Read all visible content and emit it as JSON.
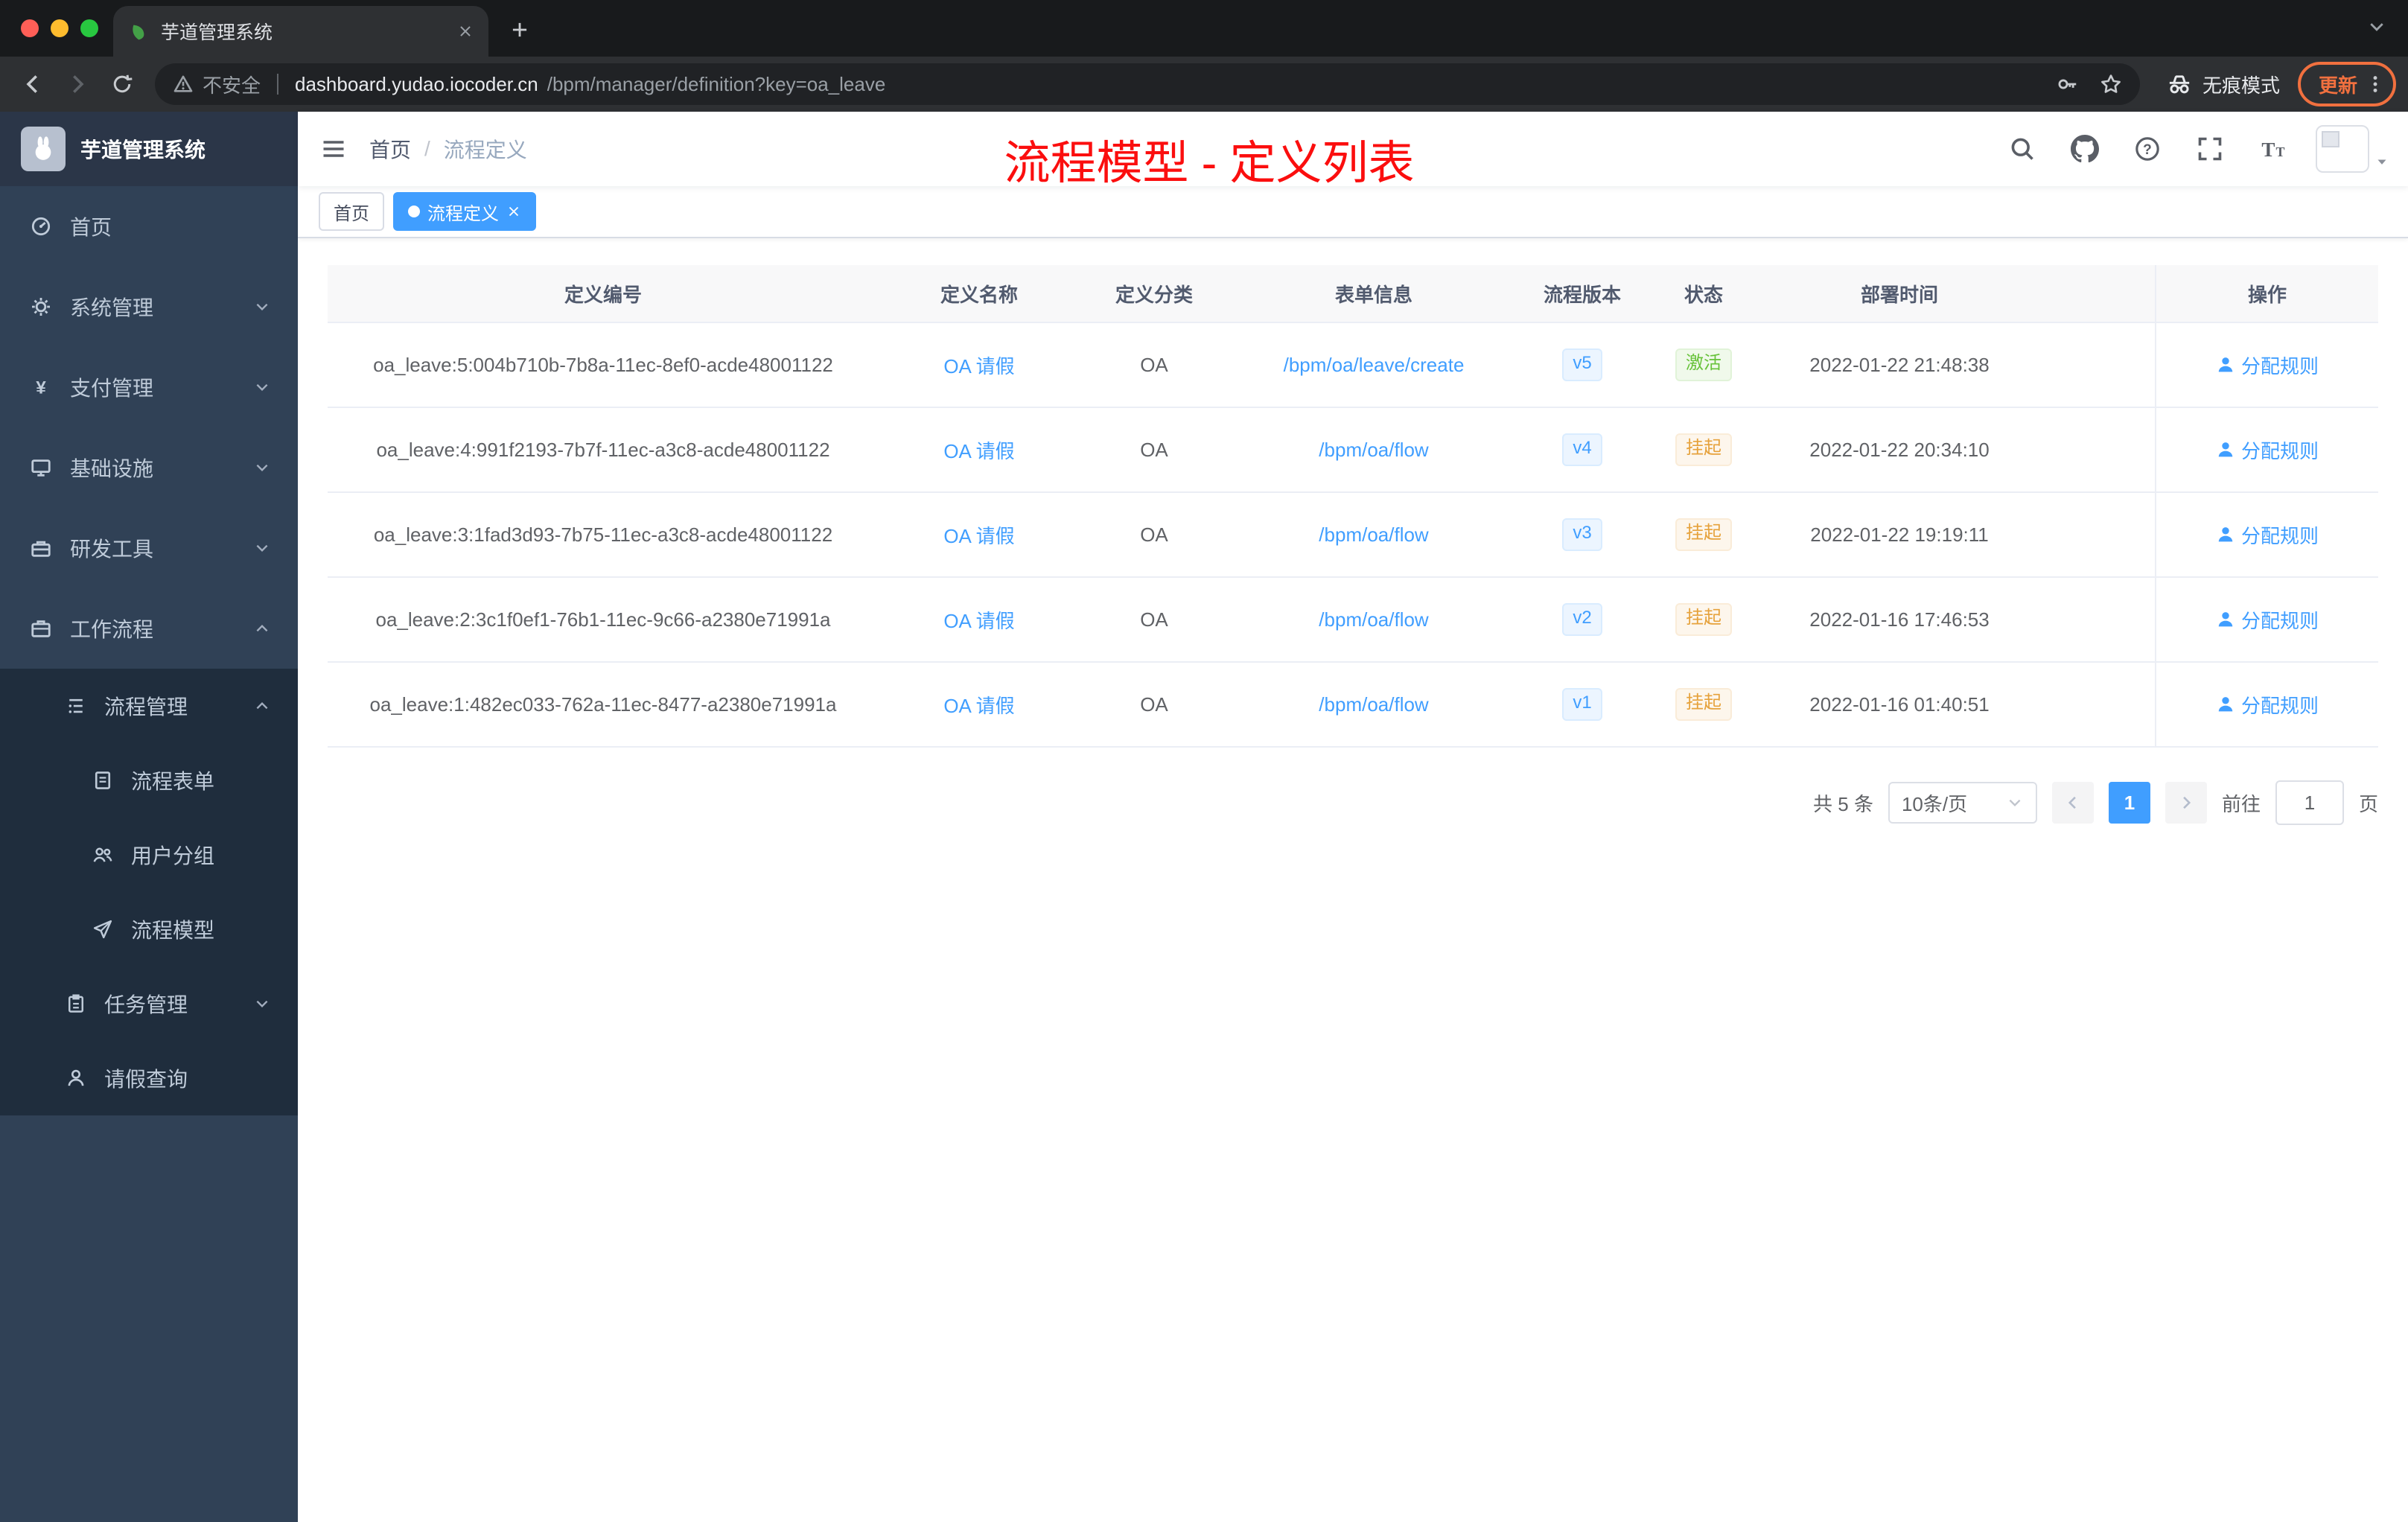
{
  "browser": {
    "tab_title": "芋道管理系统",
    "not_secure": "不安全",
    "url_host": "dashboard.yudao.iocoder.cn",
    "url_path": "/bpm/manager/definition?key=oa_leave",
    "incognito_label": "无痕模式",
    "update_label": "更新"
  },
  "sidebar": {
    "logo_title": "芋道管理系统",
    "items": [
      {
        "label": "首页"
      },
      {
        "label": "系统管理"
      },
      {
        "label": "支付管理"
      },
      {
        "label": "基础设施"
      },
      {
        "label": "研发工具"
      },
      {
        "label": "工作流程"
      },
      {
        "label": "流程管理"
      },
      {
        "label": "流程表单"
      },
      {
        "label": "用户分组"
      },
      {
        "label": "流程模型"
      },
      {
        "label": "任务管理"
      },
      {
        "label": "请假查询"
      }
    ]
  },
  "navbar": {
    "breadcrumb": [
      "首页",
      "流程定义"
    ],
    "breadcrumb_sep": "/"
  },
  "annotation": "流程模型 - 定义列表",
  "tags": [
    {
      "label": "首页"
    },
    {
      "label": "流程定义"
    }
  ],
  "table": {
    "columns": [
      "定义编号",
      "定义名称",
      "定义分类",
      "表单信息",
      "流程版本",
      "状态",
      "部署时间",
      "操作"
    ],
    "rows": [
      {
        "id": "oa_leave:5:004b710b-7b8a-11ec-8ef0-acde48001122",
        "name": "OA 请假",
        "category": "OA",
        "form": "/bpm/oa/leave/create",
        "version": "v5",
        "status": "激活",
        "time": "2022-01-22 21:48:38",
        "action": "分配规则"
      },
      {
        "id": "oa_leave:4:991f2193-7b7f-11ec-a3c8-acde48001122",
        "name": "OA 请假",
        "category": "OA",
        "form": "/bpm/oa/flow",
        "version": "v4",
        "status": "挂起",
        "time": "2022-01-22 20:34:10",
        "action": "分配规则"
      },
      {
        "id": "oa_leave:3:1fad3d93-7b75-11ec-a3c8-acde48001122",
        "name": "OA 请假",
        "category": "OA",
        "form": "/bpm/oa/flow",
        "version": "v3",
        "status": "挂起",
        "time": "2022-01-22 19:19:11",
        "action": "分配规则"
      },
      {
        "id": "oa_leave:2:3c1f0ef1-76b1-11ec-9c66-a2380e71991a",
        "name": "OA 请假",
        "category": "OA",
        "form": "/bpm/oa/flow",
        "version": "v2",
        "status": "挂起",
        "time": "2022-01-16 17:46:53",
        "action": "分配规则"
      },
      {
        "id": "oa_leave:1:482ec033-762a-11ec-8477-a2380e71991a",
        "name": "OA 请假",
        "category": "OA",
        "form": "/bpm/oa/flow",
        "version": "v1",
        "status": "挂起",
        "time": "2022-01-16 01:40:51",
        "action": "分配规则"
      }
    ]
  },
  "pagination": {
    "total": "共 5 条",
    "page_size": "10条/页",
    "current_page": "1",
    "goto_label": "前往",
    "goto_value": "1",
    "goto_unit": "页"
  },
  "colors": {
    "accent": "#409eff",
    "success": "#67c23a",
    "warning": "#e6a23c",
    "annotation_red": "#fb0e0e",
    "update_orange": "#f1703f",
    "sidebar_bg": "#304156",
    "submenu_bg": "#1f2d3d"
  },
  "icons": [
    "leaf-favicon",
    "back-icon",
    "forward-icon",
    "reload-icon",
    "warning-icon",
    "key-icon",
    "star-icon",
    "incognito-icon",
    "kebab-icon",
    "hamburger-icon",
    "search-icon",
    "github-icon",
    "help-icon",
    "fullscreen-icon",
    "font-size-icon",
    "caret-down-icon",
    "dashboard-icon",
    "gear-icon",
    "yen-icon",
    "monitor-icon",
    "toolbox-icon",
    "briefcase-icon",
    "tree-list-icon",
    "document-icon",
    "users-icon",
    "paper-plane-icon",
    "clipboard-icon",
    "person-icon",
    "user-icon",
    "rabbit-avatar"
  ]
}
